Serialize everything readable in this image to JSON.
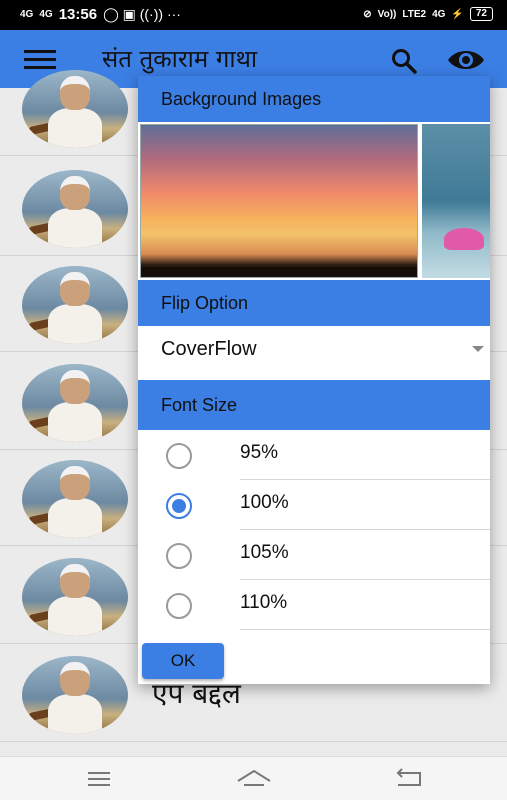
{
  "status_bar": {
    "network_left": "4G",
    "network_left2": "4G",
    "time": "13:56",
    "volte": "Vo))",
    "lte": "LTE2",
    "network_right": "4G",
    "battery": "72"
  },
  "app_bar": {
    "title": "संत तुकाराम गाथा",
    "menu_icon": "hamburger-menu-icon",
    "search_icon": "search-icon",
    "eye_icon": "eye-icon"
  },
  "list": {
    "visible_row_label": "एप बद्दल"
  },
  "dialog": {
    "background_images_title": "Background Images",
    "images": [
      "sunset",
      "water-lotus"
    ],
    "flip_option_title": "Flip Option",
    "flip_option_value": "CoverFlow",
    "font_size_title": "Font Size",
    "font_sizes": [
      {
        "label": "95%",
        "selected": false
      },
      {
        "label": "100%",
        "selected": true
      },
      {
        "label": "105%",
        "selected": false
      },
      {
        "label": "110%",
        "selected": false
      }
    ],
    "ok_label": "OK"
  },
  "colors": {
    "accent": "#3b7ee4",
    "list_bg": "#ebebeb"
  },
  "nav_bar": {
    "icons": [
      "menu-icon",
      "home-icon",
      "back-icon"
    ]
  }
}
